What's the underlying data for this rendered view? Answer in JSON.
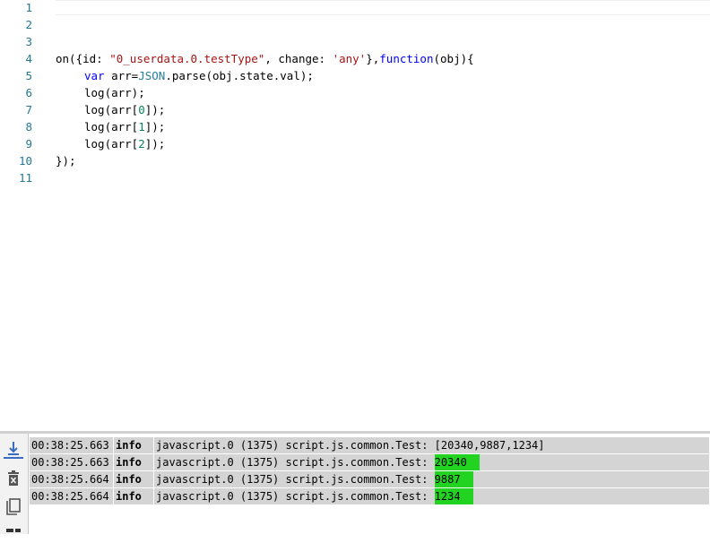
{
  "editor": {
    "line_numbers": [
      "1",
      "2",
      "3",
      "4",
      "5",
      "6",
      "7",
      "8",
      "9",
      "10",
      "11"
    ],
    "code": {
      "l4_call": "on({id: ",
      "l4_id": "\"0_userdata.0.testType\"",
      "l4_mid": ", change: ",
      "l4_change": "'any'",
      "l4_sep": "},",
      "l4_function": "function",
      "l4_tail": "(obj){",
      "l5_var": "var",
      "l5_arr": " arr=",
      "l5_json": "JSON",
      "l5_rest": ".parse(obj.state.val);",
      "l6": "log(arr);",
      "l7_a": "log(arr[",
      "l7_n": "0",
      "l7_b": "]);",
      "l8_a": "log(arr[",
      "l8_n": "1",
      "l8_b": "]);",
      "l9_a": "log(arr[",
      "l9_n": "2",
      "l9_b": "]);",
      "l10": "});"
    }
  },
  "log": {
    "toolbar": {
      "icons": [
        "scroll-to-bottom-icon",
        "clear-log-icon",
        "copy-icon",
        "filter-icon"
      ]
    },
    "rows": [
      {
        "time": "00:38:25.663",
        "severity": "info",
        "source": "javascript.0 (1375) script.js.common.Test: ",
        "value": "[20340,9887,1234]",
        "highlight": false
      },
      {
        "time": "00:38:25.663",
        "severity": "info",
        "source": "javascript.0 (1375) script.js.common.Test: ",
        "value": "20340",
        "highlight": true
      },
      {
        "time": "00:38:25.664",
        "severity": "info",
        "source": "javascript.0 (1375) script.js.common.Test: ",
        "value": "9887",
        "highlight": true
      },
      {
        "time": "00:38:25.664",
        "severity": "info",
        "source": "javascript.0 (1375) script.js.common.Test: ",
        "value": "1234",
        "highlight": true
      }
    ],
    "highlight_color": "#22d322"
  }
}
